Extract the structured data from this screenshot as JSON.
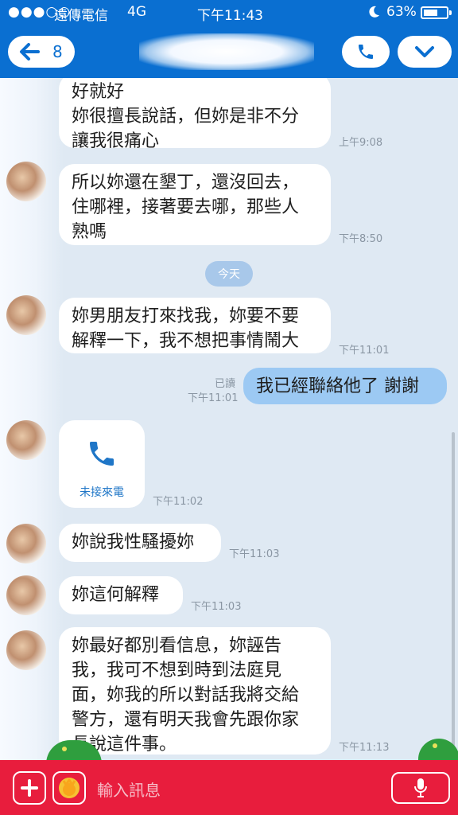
{
  "status_bar": {
    "signal": "●●●○○",
    "carrier": "遠傳電信",
    "network": "4G",
    "time": "下午11:43",
    "battery_percent": "63%",
    "battery_level": 0.63
  },
  "header": {
    "unread_count": "8"
  },
  "messages": [
    {
      "id": "m1",
      "text": "好就好\n妳很擅長說話，但妳是非不分\n讓我很痛心",
      "time": "上午9:08"
    },
    {
      "id": "m2",
      "text": "所以妳還在墾丁，還沒回去，\n住哪裡，接著要去哪，那些人\n熟嗎",
      "time": "下午8:50"
    },
    {
      "id": "m3",
      "text": "妳男朋友打來找我，妳要不要\n解釋一下，我不想把事情鬧大",
      "time": "下午11:01"
    },
    {
      "id": "m4",
      "text": "我已經聯絡他了 謝謝",
      "time": "下午11:01",
      "read": "已讀"
    },
    {
      "id": "m5",
      "call_label": "未接來電",
      "time": "下午11:02"
    },
    {
      "id": "m6",
      "text": "妳說我性騷擾妳",
      "time": "下午11:03"
    },
    {
      "id": "m7",
      "text": "妳這何解釋",
      "time": "下午11:03"
    },
    {
      "id": "m8",
      "text": "妳最好都別看信息，妳誣告\n我，我可不想到時到法庭見\n面，妳我的所以對話我將交給\n警方，還有明天我會先跟你家\n長說這件事。",
      "time": "下午11:13"
    }
  ],
  "date_divider": "今天",
  "input": {
    "placeholder": "輸入訊息"
  },
  "colors": {
    "header": "#0a6fd1",
    "bottom_bar": "#e81d3d",
    "my_bubble": "#9cc9f3",
    "missed_call": "#1f76c7"
  },
  "icons": [
    "back-arrow-icon",
    "phone-icon",
    "chevron-down-icon",
    "plus-icon",
    "sticker-icon",
    "microphone-icon",
    "moon-icon"
  ]
}
